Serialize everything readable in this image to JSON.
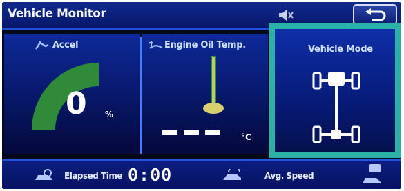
{
  "header": {
    "title": "Vehicle Monitor",
    "mute_icon": "speaker-mute-icon",
    "back_icon": "back-arrow-icon"
  },
  "accel": {
    "label": "Accel",
    "icon": "accelerator-pedal-icon",
    "value": "0",
    "unit": "%",
    "gauge_level_percent": 100
  },
  "oil": {
    "label": "Engine Oil Temp.",
    "icon": "oil-temperature-icon",
    "value": "———",
    "unit": "°C"
  },
  "vehicle_mode": {
    "label": "Vehicle Mode",
    "icon": "drivetrain-4wd-icon"
  },
  "bottom": {
    "elapsed_label": "Elapsed Time",
    "elapsed_value": "0:00",
    "avg_speed_label": "Avg. Speed",
    "avg_speed_icon": "car-speed-icon",
    "elapsed_icon": "car-clock-icon",
    "unit_icon": "speed-unit-icon"
  },
  "colors": {
    "gauge_green": "#2f8a3a",
    "accent_blue": "#4d79ff",
    "highlight_teal": "#2cb1a8",
    "oil_fill": "#d8d070"
  }
}
